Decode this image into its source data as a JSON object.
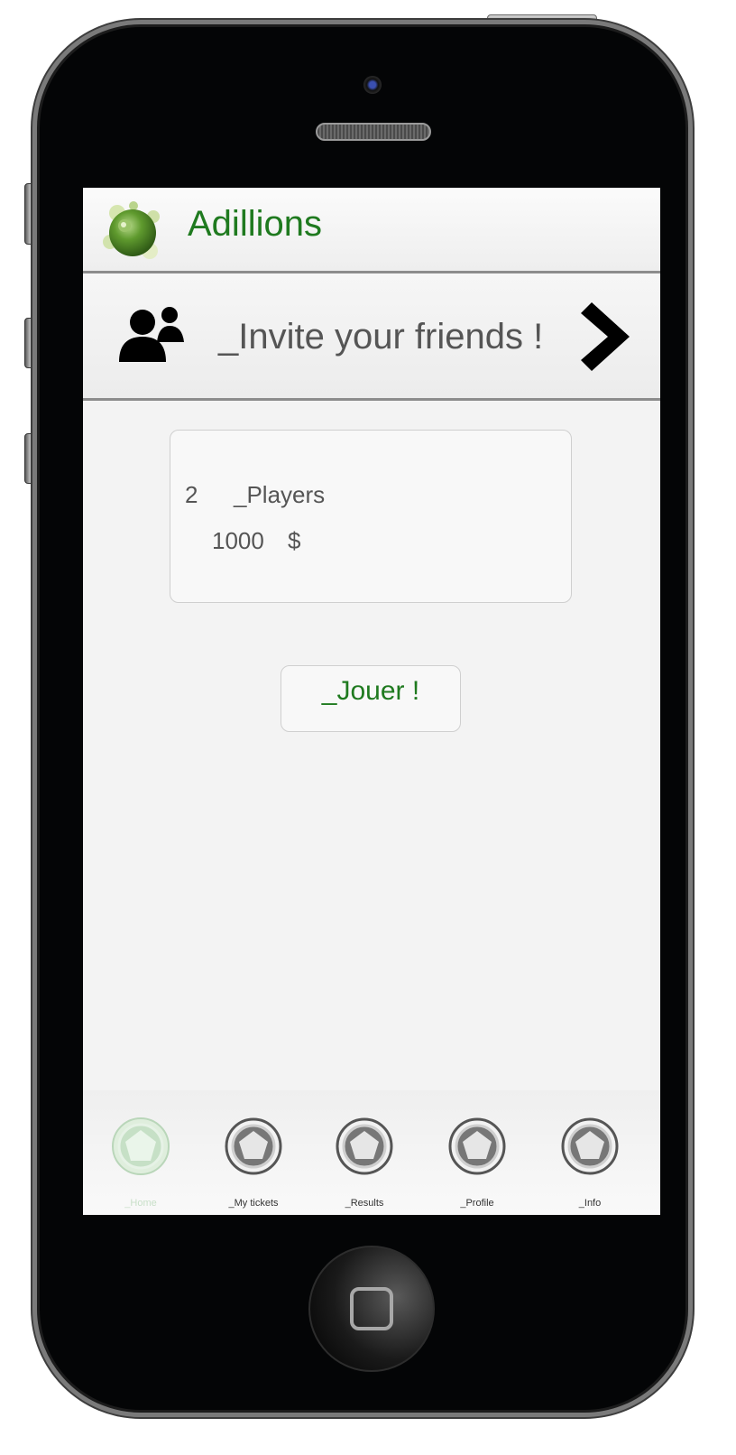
{
  "app": {
    "title": "Adillions"
  },
  "invite": {
    "label": "_Invite your friends !"
  },
  "card": {
    "players_count": "2",
    "players_label": "_Players",
    "prize_amount": "1000",
    "prize_currency": "$"
  },
  "play_button": {
    "label": "_Jouer !"
  },
  "tabs": [
    {
      "label": "_Home",
      "active": true
    },
    {
      "label": "_My tickets",
      "active": false
    },
    {
      "label": "_Results",
      "active": false
    },
    {
      "label": "_Profile",
      "active": false
    },
    {
      "label": "_Info",
      "active": false
    }
  ],
  "colors": {
    "brand_green": "#1f7a1f",
    "active_tab": "#c9e0c9"
  }
}
